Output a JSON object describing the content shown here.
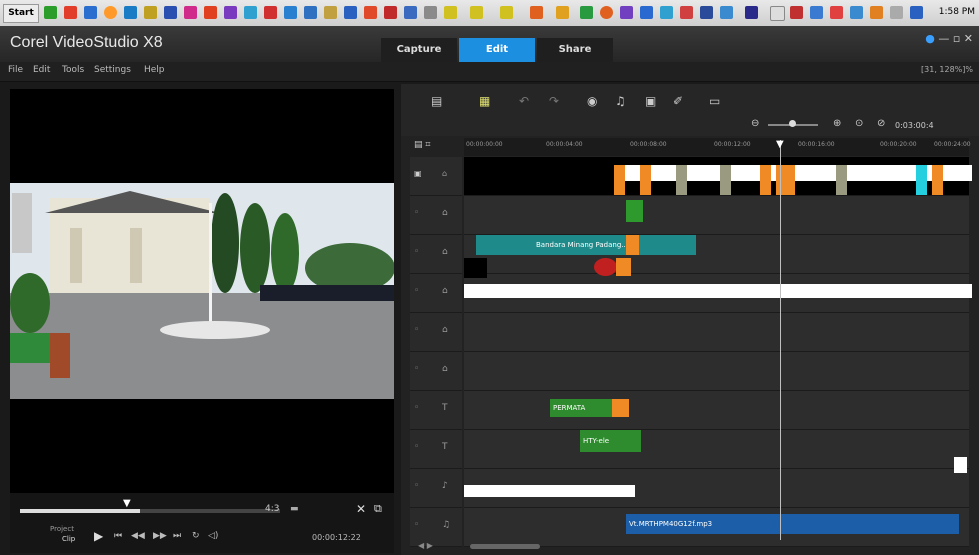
{
  "taskbar": {
    "start_label": "Start",
    "clock": "1:58 PM"
  },
  "app": {
    "title": "Corel VideoStudio X8"
  },
  "mode_tabs": [
    {
      "label": "Capture",
      "active": false
    },
    {
      "label": "Edit",
      "active": true
    },
    {
      "label": "Share",
      "active": false
    }
  ],
  "menu": [
    "File",
    "Edit",
    "Tools",
    "Settings",
    "Help"
  ],
  "status_coords": "[31, 128%]%",
  "player": {
    "project_label": "Project",
    "clip_label": "Clip",
    "timecode": "00:00:12:22"
  },
  "timeline": {
    "ruler_ticks": [
      "00:00:00:00",
      "00:00:04:00",
      "00:00:08:00",
      "00:00:12:00",
      "00:00:16:00",
      "00:00:20:00",
      "00:00:24:00"
    ],
    "zoom_timecode": "0:03:00:4",
    "clips": {
      "title_clip": "Bandara Minang Padang...",
      "overlay1": "PERMATA",
      "overlay2": "HTY-ele",
      "audio": "Vt.MRTHPM40G12f.mp3"
    }
  },
  "colors": {
    "accent": "#1d8fe0",
    "clip_green": "#2e8b2e",
    "clip_orange": "#f08a24",
    "audio_blue": "#1c5fa8"
  }
}
